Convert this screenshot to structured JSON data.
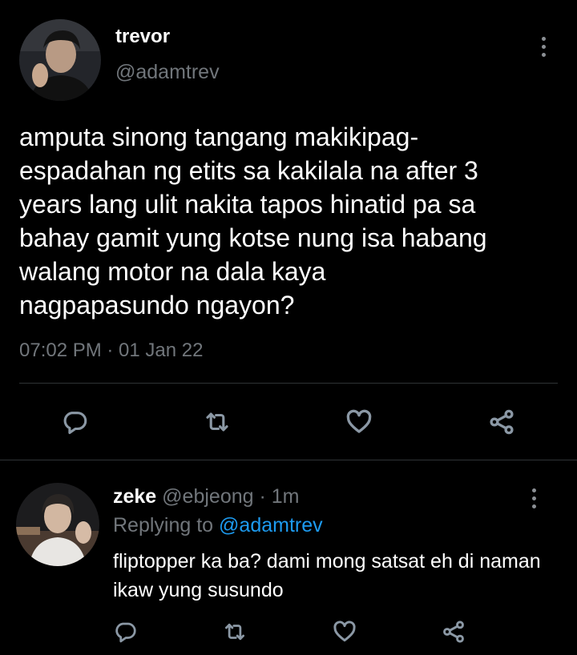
{
  "tweet": {
    "display_name": "trevor",
    "handle": "@adamtrev",
    "text": "amputa sinong tangang makikipag-\nespadahan ng etits sa kakilala na after 3\nyears lang ulit nakita tapos hinatid pa sa\nbahay gamit yung kotse nung isa habang\nwalang motor na dala kaya\nnagpapasundo ngayon?",
    "timestamp": "07:02 PM · 01 Jan 22"
  },
  "reply": {
    "display_name": "zeke",
    "handle": "@ebjeong",
    "separator": " · ",
    "time": "1m",
    "replying_prefix": "Replying to ",
    "replying_to": "@adamtrev",
    "text": "fliptopper ka ba? dami mong satsat eh di naman ikaw yung susundo"
  },
  "icons": {
    "reply": "reply-icon",
    "retweet": "retweet-icon",
    "like": "heart-icon",
    "share": "share-icon",
    "more": "more-vertical-icon"
  },
  "colors": {
    "background": "#000000",
    "text": "#ffffff",
    "secondary": "#71767b",
    "mention": "#1d9bf0",
    "divider": "#2f3336"
  }
}
